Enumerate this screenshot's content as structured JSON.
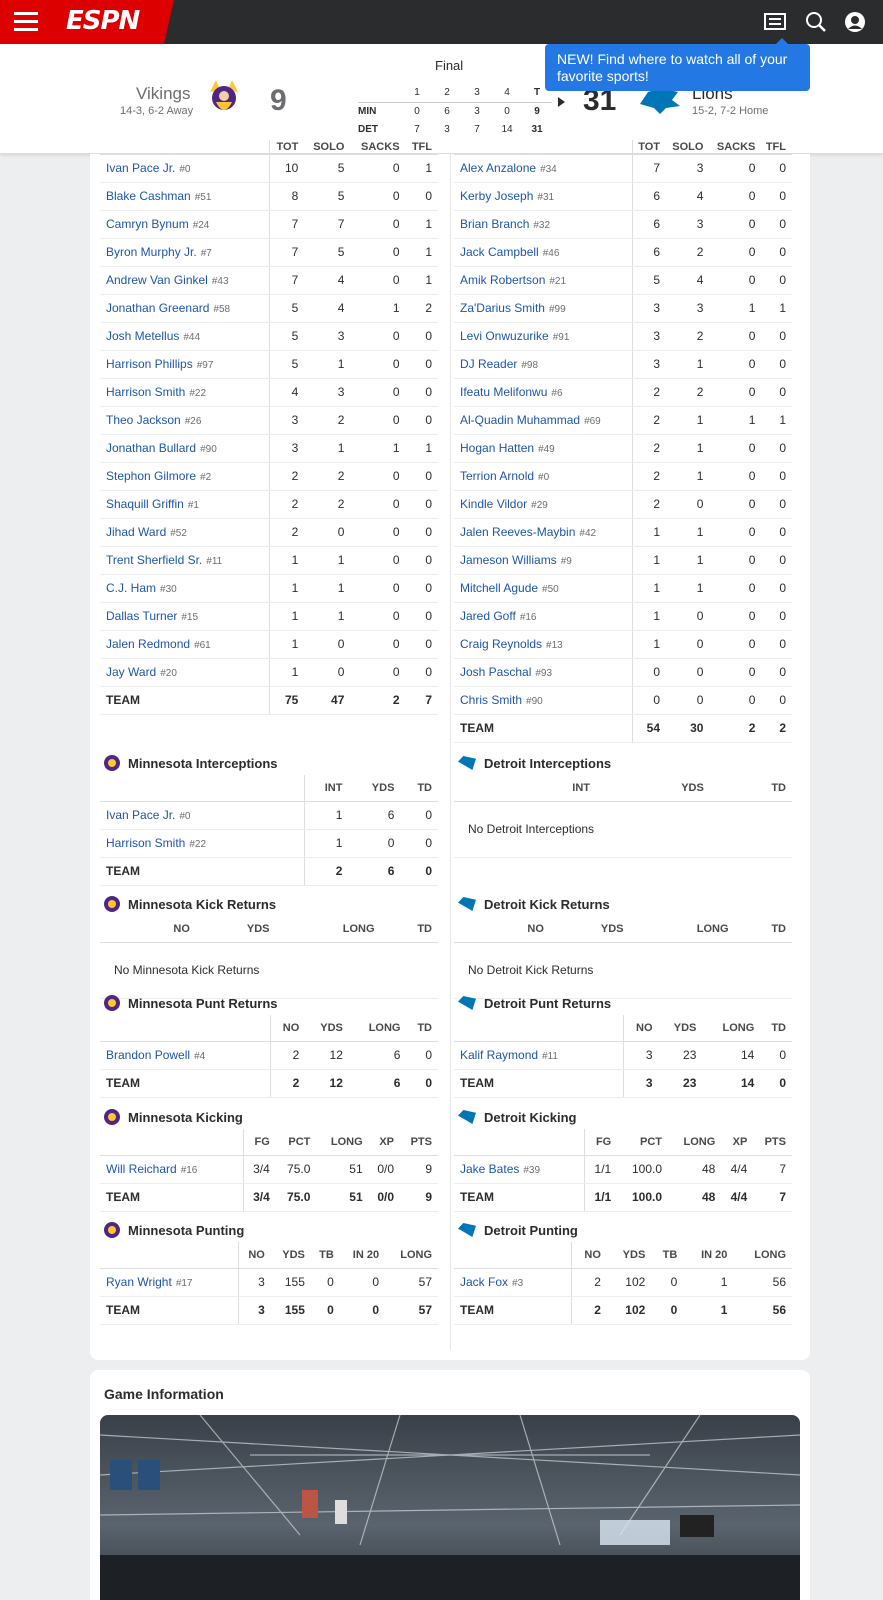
{
  "nav": {
    "logo": "ESPN",
    "tooltip": "NEW! Find where to watch all of your favorite sports!"
  },
  "game": {
    "status": "Final",
    "away": {
      "name": "Vikings",
      "record": "14-3, 6-2 Away",
      "score": "9"
    },
    "home": {
      "name": "Lions",
      "record": "15-2, 7-2 Home",
      "score": "31"
    },
    "linescore": {
      "headers": [
        "",
        "1",
        "2",
        "3",
        "4",
        "T"
      ],
      "rows": [
        [
          "MIN",
          "0",
          "6",
          "3",
          "0",
          "9"
        ],
        [
          "DET",
          "7",
          "3",
          "7",
          "14",
          "31"
        ]
      ]
    }
  },
  "defense": {
    "min": {
      "headers": [
        "",
        "TOT",
        "SOLO",
        "SACKS",
        "TFL"
      ],
      "rows": [
        [
          "Ivan Pace Jr.",
          "#0",
          "10",
          "5",
          "0",
          "1"
        ],
        [
          "Blake Cashman",
          "#51",
          "8",
          "5",
          "0",
          "0"
        ],
        [
          "Camryn Bynum",
          "#24",
          "7",
          "7",
          "0",
          "1"
        ],
        [
          "Byron Murphy Jr.",
          "#7",
          "7",
          "5",
          "0",
          "1"
        ],
        [
          "Andrew Van Ginkel",
          "#43",
          "7",
          "4",
          "0",
          "1"
        ],
        [
          "Jonathan Greenard",
          "#58",
          "5",
          "4",
          "1",
          "2"
        ],
        [
          "Josh Metellus",
          "#44",
          "5",
          "3",
          "0",
          "0"
        ],
        [
          "Harrison Phillips",
          "#97",
          "5",
          "1",
          "0",
          "0"
        ],
        [
          "Harrison Smith",
          "#22",
          "4",
          "3",
          "0",
          "0"
        ],
        [
          "Theo Jackson",
          "#26",
          "3",
          "2",
          "0",
          "0"
        ],
        [
          "Jonathan Bullard",
          "#90",
          "3",
          "1",
          "1",
          "1"
        ],
        [
          "Stephon Gilmore",
          "#2",
          "2",
          "2",
          "0",
          "0"
        ],
        [
          "Shaquill Griffin",
          "#1",
          "2",
          "2",
          "0",
          "0"
        ],
        [
          "Jihad Ward",
          "#52",
          "2",
          "0",
          "0",
          "0"
        ],
        [
          "Trent Sherfield Sr.",
          "#11",
          "1",
          "1",
          "0",
          "0"
        ],
        [
          "C.J. Ham",
          "#30",
          "1",
          "1",
          "0",
          "0"
        ],
        [
          "Dallas Turner",
          "#15",
          "1",
          "1",
          "0",
          "0"
        ],
        [
          "Jalen Redmond",
          "#61",
          "1",
          "0",
          "0",
          "0"
        ],
        [
          "Jay Ward",
          "#20",
          "1",
          "0",
          "0",
          "0"
        ]
      ],
      "team": [
        "TEAM",
        "",
        "75",
        "47",
        "2",
        "7"
      ]
    },
    "det": {
      "headers": [
        "",
        "TOT",
        "SOLO",
        "SACKS",
        "TFL"
      ],
      "rows": [
        [
          "Alex Anzalone",
          "#34",
          "7",
          "3",
          "0",
          "0"
        ],
        [
          "Kerby Joseph",
          "#31",
          "6",
          "4",
          "0",
          "0"
        ],
        [
          "Brian Branch",
          "#32",
          "6",
          "3",
          "0",
          "0"
        ],
        [
          "Jack Campbell",
          "#46",
          "6",
          "2",
          "0",
          "0"
        ],
        [
          "Amik Robertson",
          "#21",
          "5",
          "4",
          "0",
          "0"
        ],
        [
          "Za'Darius Smith",
          "#99",
          "3",
          "3",
          "1",
          "1"
        ],
        [
          "Levi Onwuzurike",
          "#91",
          "3",
          "2",
          "0",
          "0"
        ],
        [
          "DJ Reader",
          "#98",
          "3",
          "1",
          "0",
          "0"
        ],
        [
          "Ifeatu Melifonwu",
          "#6",
          "2",
          "2",
          "0",
          "0"
        ],
        [
          "Al-Quadin Muhammad",
          "#69",
          "2",
          "1",
          "1",
          "1"
        ],
        [
          "Hogan Hatten",
          "#49",
          "2",
          "1",
          "0",
          "0"
        ],
        [
          "Terrion Arnold",
          "#0",
          "2",
          "1",
          "0",
          "0"
        ],
        [
          "Kindle Vildor",
          "#29",
          "2",
          "0",
          "0",
          "0"
        ],
        [
          "Jalen Reeves-Maybin",
          "#42",
          "1",
          "1",
          "0",
          "0"
        ],
        [
          "Jameson Williams",
          "#9",
          "1",
          "1",
          "0",
          "0"
        ],
        [
          "Mitchell Agude",
          "#50",
          "1",
          "1",
          "0",
          "0"
        ],
        [
          "Jared Goff",
          "#16",
          "1",
          "0",
          "0",
          "0"
        ],
        [
          "Craig Reynolds",
          "#13",
          "1",
          "0",
          "0",
          "0"
        ],
        [
          "Josh Paschal",
          "#93",
          "0",
          "0",
          "0",
          "0"
        ],
        [
          "Chris Smith",
          "#90",
          "0",
          "0",
          "0",
          "0"
        ]
      ],
      "team": [
        "TEAM",
        "",
        "54",
        "30",
        "2",
        "2"
      ]
    }
  },
  "sections": {
    "min_int": {
      "title": "Minnesota Interceptions",
      "headers": [
        "",
        "INT",
        "YDS",
        "TD"
      ],
      "rows": [
        [
          "Ivan Pace Jr.",
          "#0",
          "1",
          "6",
          "0"
        ],
        [
          "Harrison Smith",
          "#22",
          "1",
          "0",
          "0"
        ]
      ],
      "team": [
        "TEAM",
        "",
        "2",
        "6",
        "0"
      ]
    },
    "det_int": {
      "title": "Detroit Interceptions",
      "headers": [
        "",
        "INT",
        "YDS",
        "TD"
      ],
      "empty": "No Detroit Interceptions"
    },
    "min_kr": {
      "title": "Minnesota Kick Returns",
      "headers": [
        "",
        "NO",
        "YDS",
        "LONG",
        "TD"
      ],
      "empty": "No Minnesota Kick Returns"
    },
    "det_kr": {
      "title": "Detroit Kick Returns",
      "headers": [
        "",
        "NO",
        "YDS",
        "LONG",
        "TD"
      ],
      "empty": "No Detroit Kick Returns"
    },
    "min_pr": {
      "title": "Minnesota Punt Returns",
      "headers": [
        "",
        "NO",
        "YDS",
        "LONG",
        "TD"
      ],
      "rows": [
        [
          "Brandon Powell",
          "#4",
          "2",
          "12",
          "6",
          "0"
        ]
      ],
      "team": [
        "TEAM",
        "",
        "2",
        "12",
        "6",
        "0"
      ]
    },
    "det_pr": {
      "title": "Detroit Punt Returns",
      "headers": [
        "",
        "NO",
        "YDS",
        "LONG",
        "TD"
      ],
      "rows": [
        [
          "Kalif Raymond",
          "#11",
          "3",
          "23",
          "14",
          "0"
        ]
      ],
      "team": [
        "TEAM",
        "",
        "3",
        "23",
        "14",
        "0"
      ]
    },
    "min_k": {
      "title": "Minnesota Kicking",
      "headers": [
        "",
        "FG",
        "PCT",
        "LONG",
        "XP",
        "PTS"
      ],
      "rows": [
        [
          "Will Reichard",
          "#16",
          "3/4",
          "75.0",
          "51",
          "0/0",
          "9"
        ]
      ],
      "team": [
        "TEAM",
        "",
        "3/4",
        "75.0",
        "51",
        "0/0",
        "9"
      ]
    },
    "det_k": {
      "title": "Detroit Kicking",
      "headers": [
        "",
        "FG",
        "PCT",
        "LONG",
        "XP",
        "PTS"
      ],
      "rows": [
        [
          "Jake Bates",
          "#39",
          "1/1",
          "100.0",
          "48",
          "4/4",
          "7"
        ]
      ],
      "team": [
        "TEAM",
        "",
        "1/1",
        "100.0",
        "48",
        "4/4",
        "7"
      ]
    },
    "min_p": {
      "title": "Minnesota Punting",
      "headers": [
        "",
        "NO",
        "YDS",
        "TB",
        "IN 20",
        "LONG"
      ],
      "rows": [
        [
          "Ryan Wright",
          "#17",
          "3",
          "155",
          "0",
          "0",
          "57"
        ]
      ],
      "team": [
        "TEAM",
        "",
        "3",
        "155",
        "0",
        "0",
        "57"
      ]
    },
    "det_p": {
      "title": "Detroit Punting",
      "headers": [
        "",
        "NO",
        "YDS",
        "TB",
        "IN 20",
        "LONG"
      ],
      "rows": [
        [
          "Jack Fox",
          "#3",
          "2",
          "102",
          "0",
          "1",
          "56"
        ]
      ],
      "team": [
        "TEAM",
        "",
        "2",
        "102",
        "0",
        "1",
        "56"
      ]
    }
  },
  "game_info": {
    "title": "Game Information"
  }
}
